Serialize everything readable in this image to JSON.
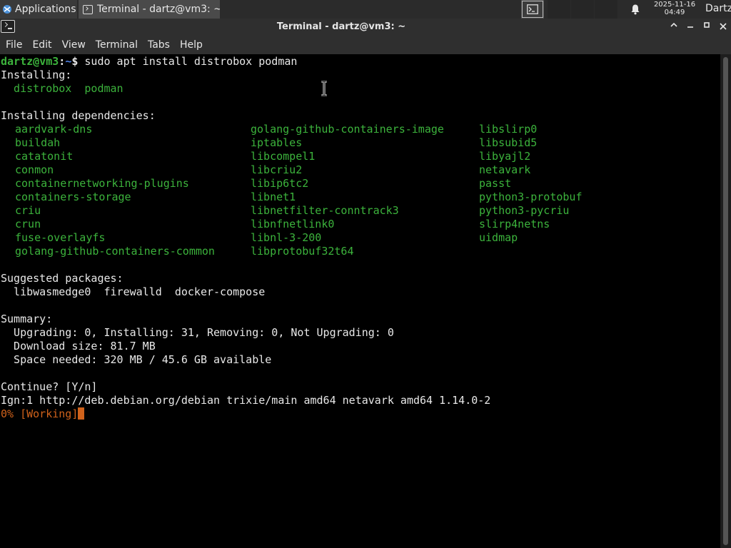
{
  "panel": {
    "apps_label": "Applications",
    "apps_suffix": "≡",
    "task_label": "Terminal - dartz@vm3: ~",
    "clock_date": "2025-11-16",
    "clock_time": "04:49",
    "user": "Dartz"
  },
  "window": {
    "title": "Terminal - dartz@vm3: ~"
  },
  "menu": [
    "File",
    "Edit",
    "View",
    "Terminal",
    "Tabs",
    "Help"
  ],
  "terminal": {
    "prompt_user": "dartz@vm3",
    "prompt_sep": ":",
    "prompt_path": "~",
    "prompt_symbol": "$",
    "command": " sudo apt install distrobox podman",
    "installing_header": "Installing:",
    "installing_pkgs": "  distrobox  podman",
    "deps_header": "Installing dependencies:",
    "deps_col1": [
      "aardvark-dns",
      "buildah",
      "catatonit",
      "conmon",
      "containernetworking-plugins",
      "containers-storage",
      "criu",
      "crun",
      "fuse-overlayfs",
      "golang-github-containers-common"
    ],
    "deps_col2": [
      "golang-github-containers-image",
      "iptables",
      "libcompel1",
      "libcriu2",
      "libip6tc2",
      "libnet1",
      "libnetfilter-conntrack3",
      "libnfnetlink0",
      "libnl-3-200",
      "libprotobuf32t64"
    ],
    "deps_col3": [
      "libslirp0",
      "libsubid5",
      "libyajl2",
      "netavark",
      "passt",
      "python3-protobuf",
      "python3-pycriu",
      "slirp4netns",
      "uidmap"
    ],
    "suggested_header": "Suggested packages:",
    "suggested_pkgs": "  libwasmedge0  firewalld  docker-compose",
    "summary_header": "Summary:",
    "summary_line1": "  Upgrading: 0, Installing: 31, Removing: 0, Not Upgrading: 0",
    "summary_line2": "  Download size: 81.7 MB",
    "summary_line3": "  Space needed: 320 MB / 45.6 GB available",
    "continue_prompt": "Continue? [Y/n]",
    "ign_line": "Ign:1 http://deb.debian.org/debian trixie/main amd64 netavark amd64 1.14.0-2",
    "progress_text": "0% [Working]"
  },
  "colors": {
    "green": "#3cb33c",
    "blue": "#4f7fe0",
    "orange": "#d0621b"
  }
}
